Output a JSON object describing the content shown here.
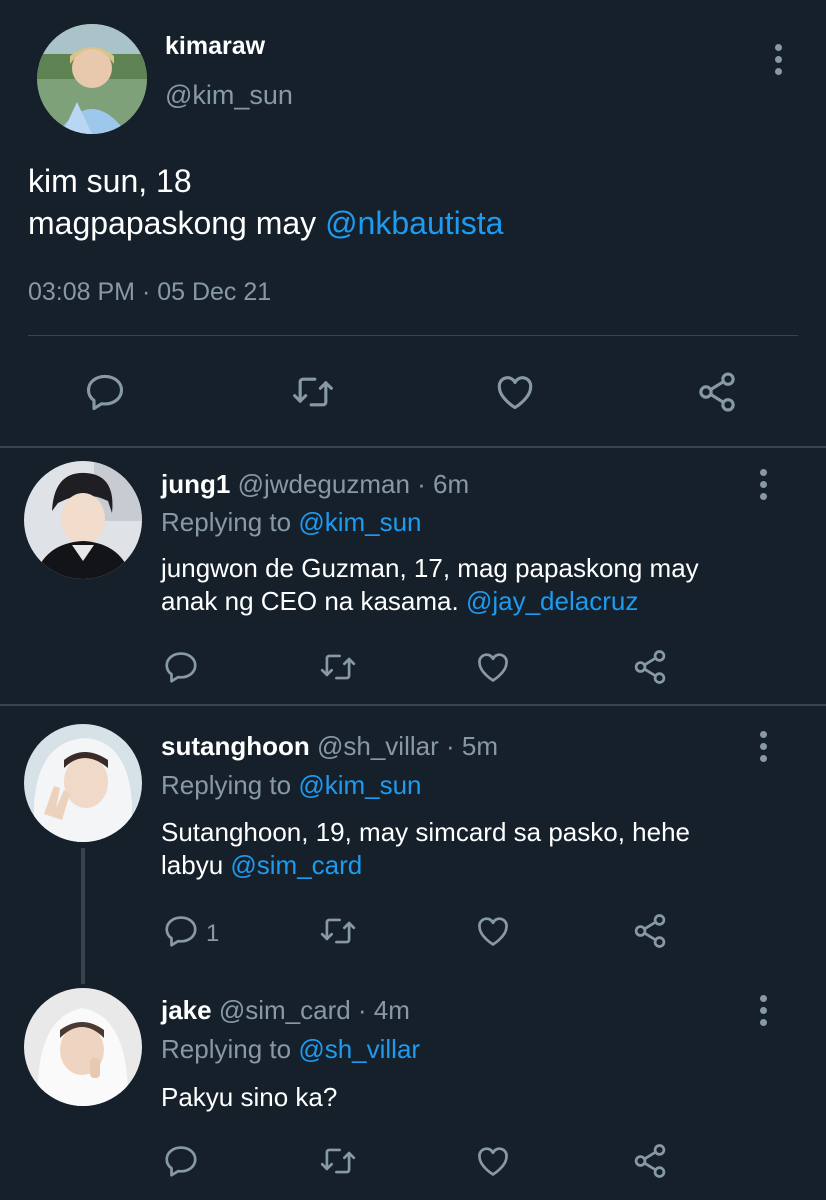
{
  "main_tweet": {
    "display_name": "kimaraw",
    "handle": "@kim_sun",
    "text_line1": "kim sun, 18",
    "text_line2_prefix": "magpapaskong may ",
    "mention": "@nkbautista",
    "timestamp": "03:08 PM · 05 Dec 21",
    "actions": [
      "reply-icon",
      "retweet-icon",
      "like-icon",
      "share-icon"
    ]
  },
  "replies": [
    {
      "display_name": "jung1",
      "meta": " @jwdeguzman · 6m",
      "replying_label": "Replying to ",
      "replying_to": "@kim_sun",
      "text_line1": "jungwon de Guzman, 17, mag papaskong may",
      "text_line2_prefix": "anak ng CEO na kasama. ",
      "mention": "@jay_delacruz",
      "reply_count": ""
    },
    {
      "display_name": "sutanghoon",
      "meta": " @sh_villar · 5m",
      "replying_label": "Replying to ",
      "replying_to": "@kim_sun",
      "text_line1": "Sutanghoon, 19, may simcard sa pasko, hehe",
      "text_line2_prefix": "labyu ",
      "mention": "@sim_card",
      "reply_count": "1"
    },
    {
      "display_name": "jake",
      "meta": " @sim_card · 4m",
      "replying_label": "Replying to ",
      "replying_to": "@sh_villar",
      "text_line1": "Pakyu sino ka?",
      "reply_count": ""
    }
  ],
  "colors": {
    "background": "#15202b",
    "secondary_text": "#8899a6",
    "link": "#1d9bf0",
    "divider": "#38444d"
  }
}
